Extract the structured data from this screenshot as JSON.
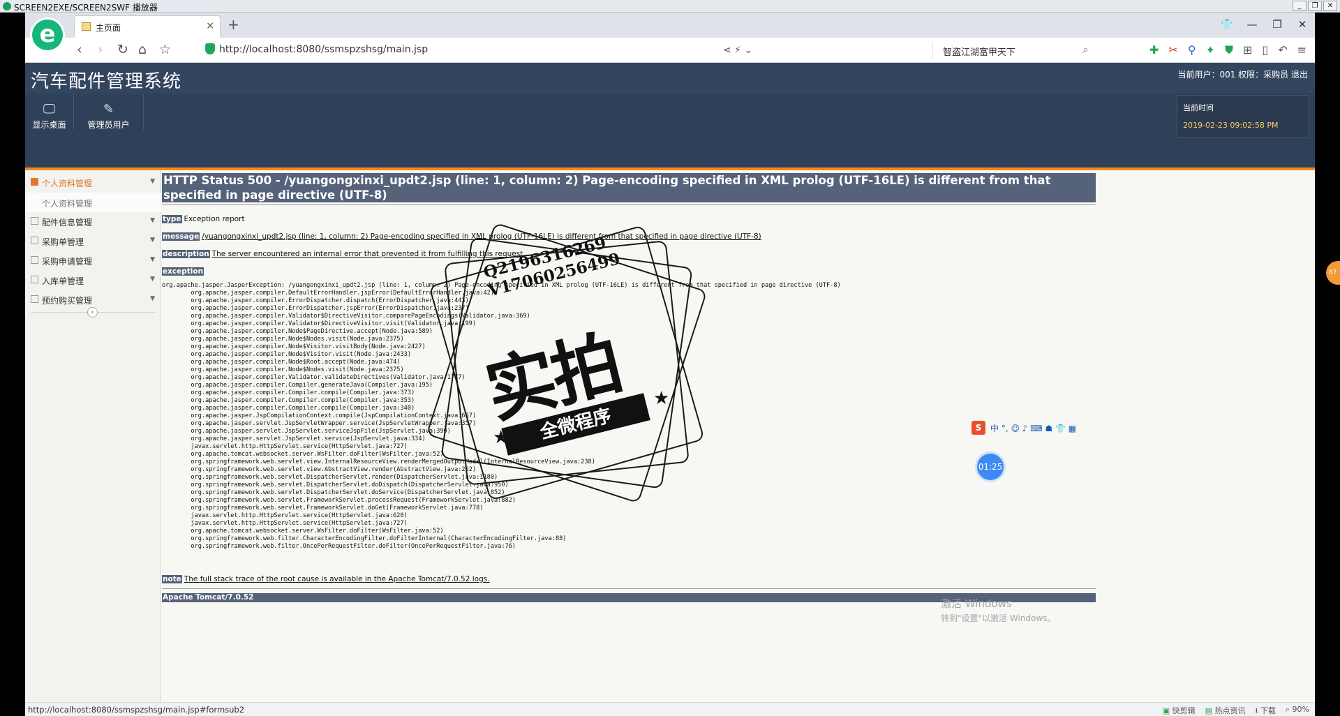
{
  "player": {
    "title": "SCREEN2EXE/SCREEN2SWF 播放器"
  },
  "browser": {
    "tab_label": "主页面",
    "url": "http://localhost:8080/ssmspzshsg/main.jsp",
    "search_text": "智盗江湖富甲天下",
    "status_url": "http://localhost:8080/ssmspzshsg/main.jsp#formsub2",
    "status_items": [
      "快剪辑",
      "热点资讯",
      "下载",
      "90%"
    ],
    "logo_letter": "e"
  },
  "app": {
    "title": "汽车配件管理系统",
    "user_info": "当前用户：001  权限：采购员  退出",
    "nav": [
      {
        "label": "显示桌面",
        "icon": "monitor-icon"
      },
      {
        "label": "管理员用户",
        "icon": "pencil-icon"
      }
    ],
    "time_label": "当前时间",
    "time_value": "2019-02-23 09:02:58 PM",
    "sidebar": [
      {
        "label": "个人资料管理",
        "active": true
      },
      {
        "label": "配件信息管理"
      },
      {
        "label": "采购单管理"
      },
      {
        "label": "采购申请管理"
      },
      {
        "label": "入库单管理"
      },
      {
        "label": "预约购买管理"
      }
    ],
    "sidebar_sub": "个人资料管理"
  },
  "error": {
    "heading": "HTTP Status 500 - /yuangongxinxi_updt2.jsp (line: 1, column: 2) Page-encoding specified in XML prolog (UTF-16LE) is different from that specified in page directive (UTF-8)",
    "type_label": "type",
    "type_text": "Exception report",
    "message_label": "message",
    "message_text": "/yuangongxinxi_updt2.jsp (line: 1, column: 2) Page-encoding specified in XML prolog (UTF-16LE) is different from that specified in page directive (UTF-8)",
    "description_label": "description",
    "description_text": "The server encountered an internal error that prevented it from fulfilling this request.",
    "exception_label": "exception",
    "stack": [
      "org.apache.jasper.JasperException: /yuangongxinxi_updt2.jsp (line: 1, column: 2) Page-encoding specified in XML prolog (UTF-16LE) is different from that specified in page directive (UTF-8)",
      "\torg.apache.jasper.compiler.DefaultErrorHandler.jspError(DefaultErrorHandler.java:42)",
      "\torg.apache.jasper.compiler.ErrorDispatcher.dispatch(ErrorDispatcher.java:443)",
      "\torg.apache.jasper.compiler.ErrorDispatcher.jspError(ErrorDispatcher.java:237)",
      "\torg.apache.jasper.compiler.Validator$DirectiveVisitor.comparePageEncodings(Validator.java:369)",
      "\torg.apache.jasper.compiler.Validator$DirectiveVisitor.visit(Validator.java:199)",
      "\torg.apache.jasper.compiler.Node$PageDirective.accept(Node.java:589)",
      "\torg.apache.jasper.compiler.Node$Nodes.visit(Node.java:2375)",
      "\torg.apache.jasper.compiler.Node$Visitor.visitBody(Node.java:2427)",
      "\torg.apache.jasper.compiler.Node$Visitor.visit(Node.java:2433)",
      "\torg.apache.jasper.compiler.Node$Root.accept(Node.java:474)",
      "\torg.apache.jasper.compiler.Node$Nodes.visit(Node.java:2375)",
      "\torg.apache.jasper.compiler.Validator.validateDirectives(Validator.java:1777)",
      "\torg.apache.jasper.compiler.Compiler.generateJava(Compiler.java:195)",
      "\torg.apache.jasper.compiler.Compiler.compile(Compiler.java:373)",
      "\torg.apache.jasper.compiler.Compiler.compile(Compiler.java:353)",
      "\torg.apache.jasper.compiler.Compiler.compile(Compiler.java:340)",
      "\torg.apache.jasper.JspCompilationContext.compile(JspCompilationContext.java:657)",
      "\torg.apache.jasper.servlet.JspServletWrapper.service(JspServletWrapper.java:357)",
      "\torg.apache.jasper.servlet.JspServlet.serviceJspFile(JspServlet.java:390)",
      "\torg.apache.jasper.servlet.JspServlet.service(JspServlet.java:334)",
      "\tjavax.servlet.http.HttpServlet.service(HttpServlet.java:727)",
      "\torg.apache.tomcat.websocket.server.WsFilter.doFilter(WsFilter.java:52)",
      "\torg.springframework.web.servlet.view.InternalResourceView.renderMergedOutputModel(InternalResourceView.java:238)",
      "\torg.springframework.web.servlet.view.AbstractView.render(AbstractView.java:262)",
      "\torg.springframework.web.servlet.DispatcherServlet.render(DispatcherServlet.java:1180)",
      "\torg.springframework.web.servlet.DispatcherServlet.doDispatch(DispatcherServlet.java:950)",
      "\torg.springframework.web.servlet.DispatcherServlet.doService(DispatcherServlet.java:852)",
      "\torg.springframework.web.servlet.FrameworkServlet.processRequest(FrameworkServlet.java:882)",
      "\torg.springframework.web.servlet.FrameworkServlet.doGet(FrameworkServlet.java:778)",
      "\tjavax.servlet.http.HttpServlet.service(HttpServlet.java:620)",
      "\tjavax.servlet.http.HttpServlet.service(HttpServlet.java:727)",
      "\torg.apache.tomcat.websocket.server.WsFilter.doFilter(WsFilter.java:52)",
      "\torg.springframework.web.filter.CharacterEncodingFilter.doFilterInternal(CharacterEncodingFilter.java:88)",
      "\torg.springframework.web.filter.OncePerRequestFilter.doFilter(OncePerRequestFilter.java:76)"
    ],
    "note_label": "note",
    "note_text": "The full stack trace of the root cause is available in the Apache Tomcat/7.0.52 logs.",
    "server": "Apache Tomcat/7.0.52"
  },
  "watermark": {
    "qq": "Q2196316269",
    "wechat": "V17060256499",
    "big": "实拍",
    "ribbon": "全微程序"
  },
  "windows": {
    "activate": "激活 Windows",
    "activate_sub": "转到\"设置\"以激活 Windows。"
  },
  "overlay": {
    "timer": "01:25",
    "ime_logo": "S",
    "ime_text": "中 °, ☺ ♪ ⌨ ☗ 👕 ▦",
    "side_badge": "87"
  },
  "colors": {
    "header": "#33465f",
    "accent": "#f08a1c",
    "error_bar": "#56627a"
  }
}
